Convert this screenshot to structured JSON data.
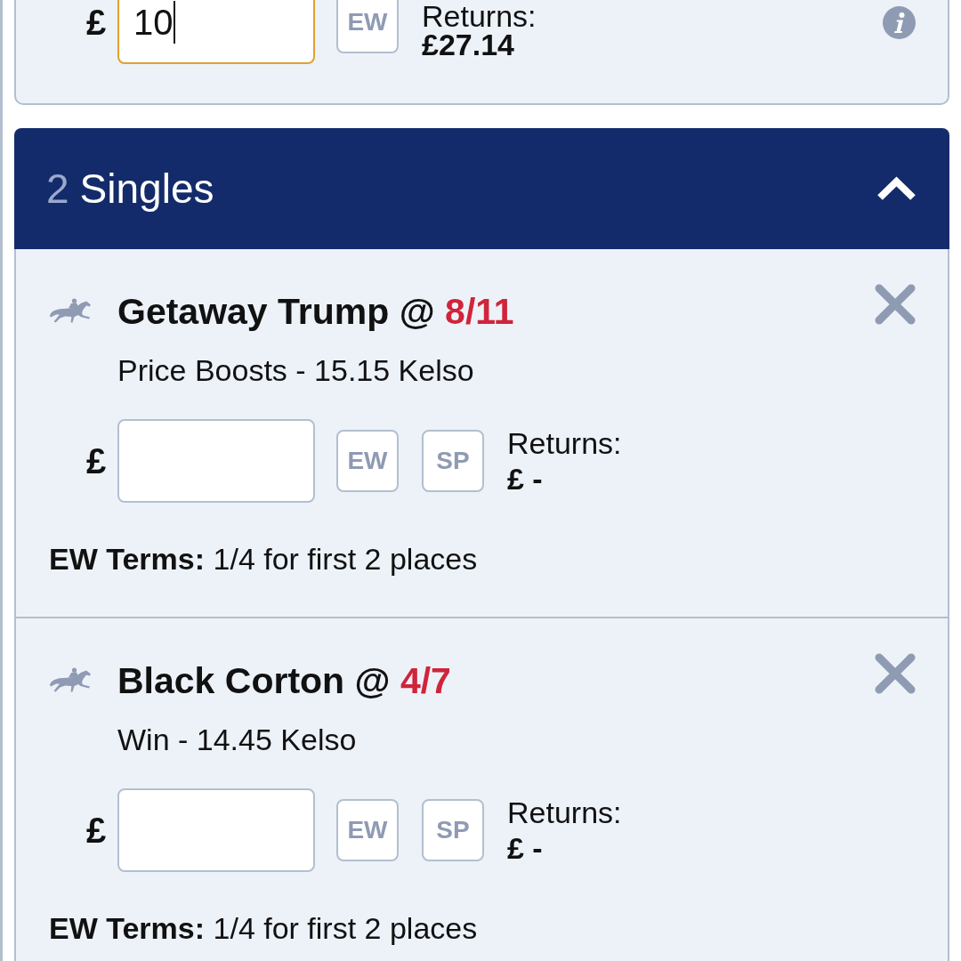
{
  "top_bet": {
    "currency": "£",
    "stake": "10",
    "focused": true,
    "toggles": [
      {
        "label": "EW",
        "selected": false
      }
    ],
    "returns_label": "Returns:",
    "returns": "£27.14"
  },
  "singles": {
    "count": "2",
    "title": "Singles",
    "expanded": true,
    "bets": [
      {
        "kind": "horse_racing",
        "selection": "Getaway Trump @",
        "odds": "8/11",
        "market": "Price Boosts - 15.15 Kelso",
        "currency": "£",
        "focused": false,
        "toggles": [
          {
            "label": "EW",
            "selected": false
          },
          {
            "label": "SP",
            "selected": false
          }
        ],
        "returns_label": "Returns:",
        "returns": "£ -",
        "terms": "**EW Terms:** 1/4 for first 2 places"
      },
      {
        "kind": "horse_racing",
        "selection": "Black Corton @",
        "odds": "4/7",
        "market": "Win - 14.45 Kelso",
        "currency": "£",
        "focused": false,
        "toggles": [
          {
            "label": "EW",
            "selected": false
          },
          {
            "label": "SP",
            "selected": false
          }
        ],
        "returns_label": "Returns:",
        "returns": "£ -",
        "terms": "**EW Terms:** 1/4 for first 2 places"
      }
    ]
  }
}
